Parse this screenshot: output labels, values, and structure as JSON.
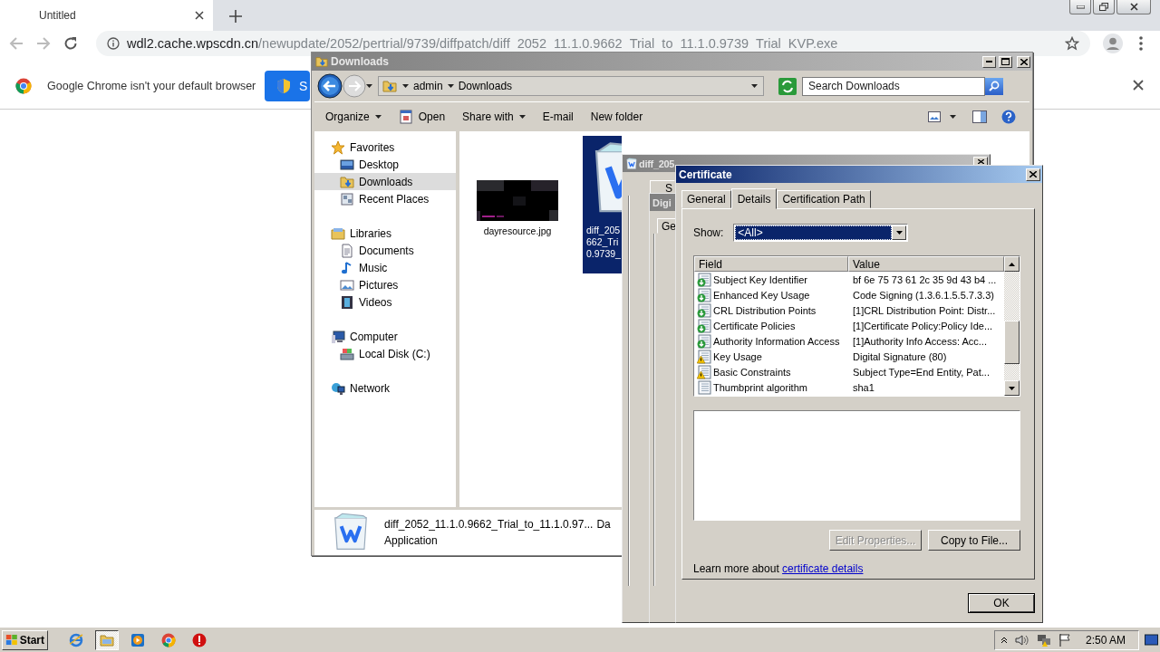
{
  "browser": {
    "tabs": [
      {
        "label": "Untitled",
        "selected": true
      }
    ],
    "url": {
      "host": "wdl2.cache.wpscdn.cn",
      "path": "/newupdate/2052/pertrial/9739/diffpatch/diff_2052_11.1.0.9662_Trial_to_11.1.0.9739_Trial_KVP.exe"
    },
    "infobar": {
      "message": "Google Chrome isn't your default browser",
      "button": "S"
    }
  },
  "explorer": {
    "title": "Downloads",
    "breadcrumb": [
      "admin",
      "Downloads"
    ],
    "search_placeholder": "Search Downloads",
    "toolbar": [
      {
        "label": "Organize",
        "kind": "menu"
      },
      {
        "label": "Open",
        "kind": "icon"
      },
      {
        "label": "Share with",
        "kind": "menu"
      },
      {
        "label": "E-mail",
        "kind": "plain"
      },
      {
        "label": "New folder",
        "kind": "plain"
      }
    ],
    "nav": [
      {
        "label": "Favorites",
        "kind": "star",
        "selected": false,
        "children": [
          {
            "label": "Desktop",
            "kind": "desktop",
            "selected": false
          },
          {
            "label": "Downloads",
            "kind": "downloads",
            "selected": true
          },
          {
            "label": "Recent Places",
            "kind": "recent",
            "selected": false
          }
        ]
      },
      {
        "label": "Libraries",
        "kind": "library",
        "selected": false,
        "children": [
          {
            "label": "Documents",
            "kind": "document",
            "selected": false
          },
          {
            "label": "Music",
            "kind": "music",
            "selected": false
          },
          {
            "label": "Pictures",
            "kind": "pictures",
            "selected": false
          },
          {
            "label": "Videos",
            "kind": "videos",
            "selected": false
          }
        ]
      },
      {
        "label": "Computer",
        "kind": "computer",
        "selected": false,
        "children": [
          {
            "label": "Local Disk (C:)",
            "kind": "disk",
            "selected": false
          }
        ]
      },
      {
        "label": "Network",
        "kind": "network",
        "selected": false
      }
    ],
    "files": [
      {
        "name": [
          "dayresource.jpg"
        ],
        "kind": "picture",
        "selected": false
      },
      {
        "name": [
          "diff_205",
          "662_Tri",
          "0.9739_"
        ],
        "kind": "app",
        "selected": true
      }
    ],
    "details": {
      "name": "diff_2052_11.1.0.9662_Trial_to_11.1.0.97...",
      "extra": "Da",
      "type": "Application"
    }
  },
  "properties_window": {
    "title": "diff_205",
    "tab": "S"
  },
  "signature_window": {
    "title": "Digi",
    "tab": "Ge"
  },
  "certificate": {
    "title": "Certificate",
    "tabs": [
      {
        "label": "General",
        "selected": false
      },
      {
        "label": "Details",
        "selected": true
      },
      {
        "label": "Certification Path",
        "selected": false
      }
    ],
    "show_label": "Show:",
    "show_value": "<All>",
    "columns": [
      "Field",
      "Value"
    ],
    "rows": [
      {
        "field": "Subject Key Identifier",
        "value": "bf 6e 75 73 61 2c 35 9d 43 b4 ...",
        "kind": "extension"
      },
      {
        "field": "Enhanced Key Usage",
        "value": "Code Signing (1.3.6.1.5.5.7.3.3)",
        "kind": "extension"
      },
      {
        "field": "CRL Distribution Points",
        "value": "[1]CRL Distribution Point: Distr...",
        "kind": "extension"
      },
      {
        "field": "Certificate Policies",
        "value": "[1]Certificate Policy:Policy Ide...",
        "kind": "extension"
      },
      {
        "field": "Authority Information Access",
        "value": "[1]Authority Info Access: Acc...",
        "kind": "extension"
      },
      {
        "field": "Key Usage",
        "value": "Digital Signature (80)",
        "kind": "critical"
      },
      {
        "field": "Basic Constraints",
        "value": "Subject Type=End Entity, Pat...",
        "kind": "critical"
      },
      {
        "field": "Thumbprint algorithm",
        "value": "sha1",
        "kind": "property"
      }
    ],
    "buttons": [
      {
        "label": "Edit Properties...",
        "disabled": true
      },
      {
        "label": "Copy to File...",
        "disabled": false
      }
    ],
    "learn_more": "Learn more about",
    "link": "certificate details",
    "ok": "OK"
  },
  "taskbar": {
    "start": "Start",
    "apps": [
      {
        "kind": "ie",
        "selected": false
      },
      {
        "kind": "explorer",
        "selected": true
      },
      {
        "kind": "media",
        "selected": false
      },
      {
        "kind": "chrome",
        "selected": false
      },
      {
        "kind": "stop",
        "selected": false
      }
    ],
    "clock": "2:50 AM"
  }
}
